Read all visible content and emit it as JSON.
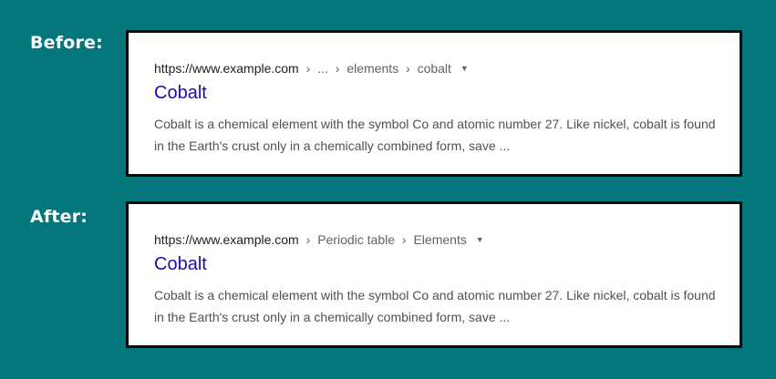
{
  "labels": {
    "before": "Before:",
    "after": "After:"
  },
  "before": {
    "domain": "https://www.example.com",
    "path": [
      "...",
      "elements",
      "cobalt"
    ],
    "title": "Cobalt",
    "snippet": "Cobalt is a chemical element with the symbol Co and atomic number 27. Like nickel, cobalt is found in the Earth's crust only in a chemically combined form, save ..."
  },
  "after": {
    "domain": "https://www.example.com",
    "path": [
      "Periodic table",
      "Elements"
    ],
    "title": "Cobalt",
    "snippet": "Cobalt is a chemical element with the symbol Co and atomic number 27. Like nickel, cobalt is found in the Earth's crust only in a chemically combined form, save ..."
  },
  "ui": {
    "separator": "›",
    "caret": "▼"
  },
  "colors": {
    "background": "#03777b",
    "link": "#1a0dab",
    "snippet": "#4d5156",
    "breadcrumb": "#5f6368"
  }
}
